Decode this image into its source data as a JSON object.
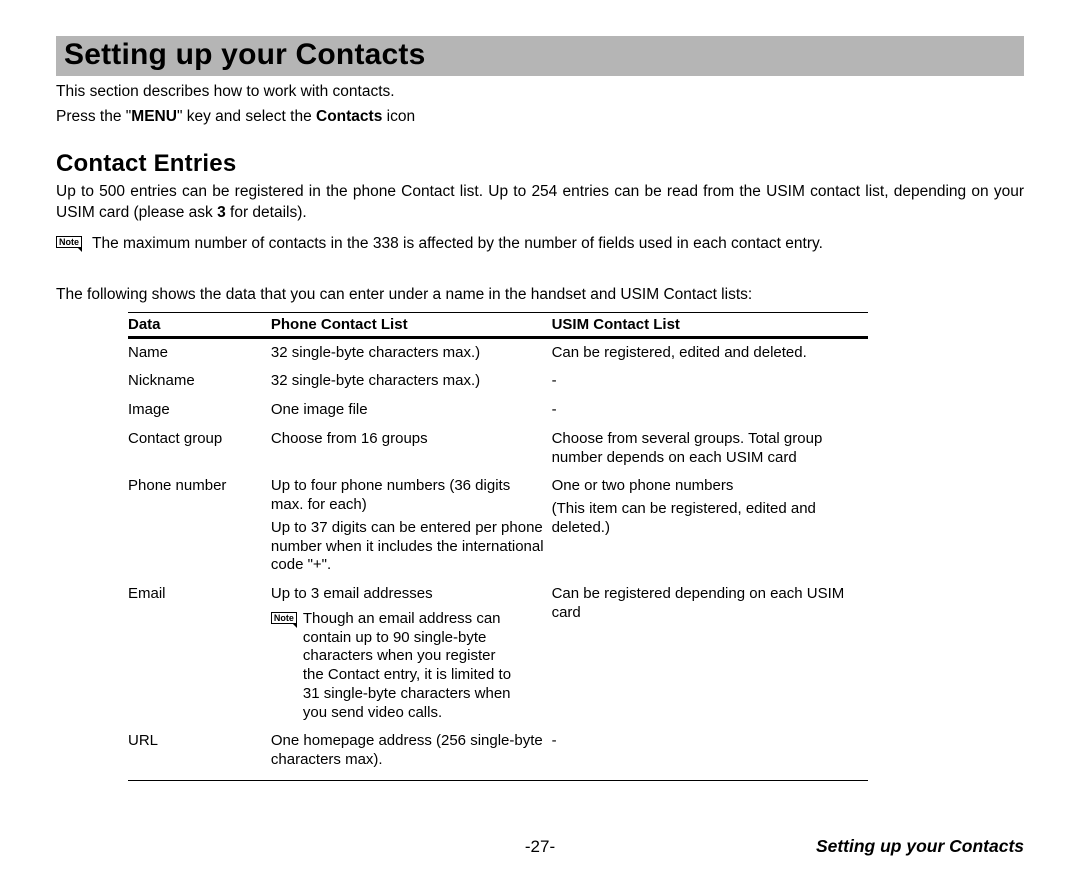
{
  "title": "Setting up your Contacts",
  "intro": "This section describes how to work with contacts.",
  "instruction_pre": "Press the \"",
  "instruction_menu": "MENU",
  "instruction_mid": "\" key and select the ",
  "instruction_contacts": "Contacts",
  "instruction_post": " icon",
  "section_heading": "Contact Entries",
  "capacity_pre": "Up to 500 entries can be registered in the phone Contact list. Up to 254 entries can be read from the USIM contact list, depending on your USIM card (please ask ",
  "capacity_bold": "3",
  "capacity_post": " for details).",
  "note_label": "Note",
  "main_note": "The maximum number of contacts in the 338 is affected by the number of fields used in each contact entry.",
  "table_lead": "The following shows the data that you can enter under a name in the handset and USIM Contact lists:",
  "columns": {
    "data": "Data",
    "phone": "Phone Contact List",
    "usim": "USIM Contact List"
  },
  "rows": [
    {
      "data": "Name",
      "phone": "32 single-byte characters max.)",
      "usim": "Can be registered, edited and deleted."
    },
    {
      "data": "Nickname",
      "phone": "32 single-byte characters max.)",
      "usim": "-"
    },
    {
      "data": "Image",
      "phone": "One image file",
      "usim": "-"
    },
    {
      "data": "Contact group",
      "phone": "Choose from 16 groups",
      "usim": "Choose from several groups. Total group number depends on each USIM card"
    },
    {
      "data": "Phone number",
      "phone": "Up to four phone numbers (36 digits max. for each)",
      "phone_extra": "Up to 37 digits can be entered per phone number when it includes the international code \"+\".",
      "usim": "One or two phone numbers",
      "usim_extra": "(This item can be registered, edited and deleted.)"
    },
    {
      "data": "Email",
      "phone": "Up to 3 email addresses",
      "usim": "Can be registered depending on each USIM card",
      "phone_note": "Though an email address can contain up to 90 single-byte characters when you register the Contact entry, it is limited to 31 single-byte characters when you send video calls."
    },
    {
      "data": "URL",
      "phone": "One homepage address (256 single-byte characters max).",
      "usim": "-"
    }
  ],
  "page_number": "-27-",
  "footer_title": "Setting up your Contacts"
}
